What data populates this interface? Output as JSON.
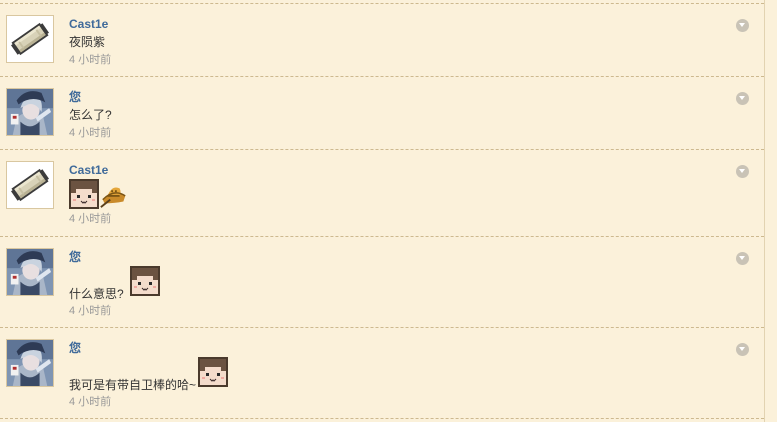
{
  "messages": [
    {
      "sender": "Cast1e",
      "text": "夜陨紫",
      "time": "4 小时前"
    },
    {
      "sender": "您",
      "text": "怎么了?",
      "time": "4 小时前"
    },
    {
      "sender": "Cast1e",
      "text": "",
      "time": "4 小时前"
    },
    {
      "sender": "您",
      "text": "什么意思?",
      "time": "4 小时前"
    },
    {
      "sender": "您",
      "text": "我可是有带自卫棒的哈~",
      "time": "4 小时前"
    }
  ],
  "icons": {
    "cast1e_avatar": "paper-scroll-icon",
    "user_avatar": "anime-character-avatar",
    "menu": "chevron-down-icon",
    "emoticon_face": "blocky-face-emoticon",
    "emoticon_hat": "safari-hat-emoticon"
  },
  "colors": {
    "background": "#fbf1da",
    "name": "#3f6a9a",
    "text": "#333333",
    "time": "#999999",
    "divider": "#cdb98f"
  }
}
